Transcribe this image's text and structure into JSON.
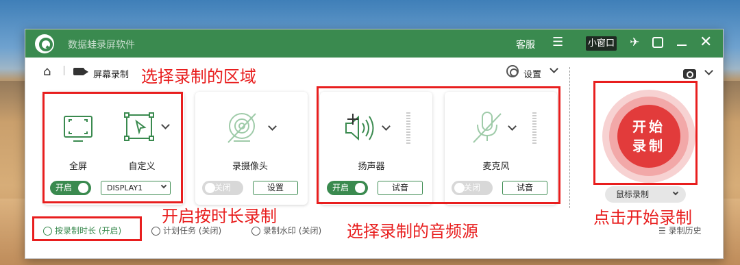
{
  "titlebar": {
    "app_title": "数据蛙录屏软件",
    "service": "客服",
    "menu_icon": "menu-icon",
    "mini_window": "小窗口"
  },
  "breadcrumb": {
    "label": "屏幕录制"
  },
  "settings": {
    "label": "设置"
  },
  "screen_card": {
    "full_label": "全屏",
    "custom_label": "自定义",
    "toggle": "开启",
    "display": "DISPLAY1"
  },
  "camera_card": {
    "label": "录摄像头",
    "toggle": "关闭",
    "button": "设置"
  },
  "speaker_card": {
    "label": "扬声器",
    "toggle": "开启",
    "button": "试音"
  },
  "mic_card": {
    "label": "麦克风",
    "toggle": "关闭",
    "button": "试音"
  },
  "record": {
    "line1": "开始",
    "line2": "录制",
    "mouse_label": "鼠标录制"
  },
  "bottom_bar": {
    "duration": "按录制时长 (开启)",
    "schedule": "计划任务 (关闭)",
    "watermark": "录制水印 (关闭)",
    "history": "录制历史"
  },
  "annotations": {
    "select_area": "选择录制的区域",
    "duration": "开启按时长录制",
    "audio_source": "选择录制的音频源",
    "start": "点击开始录制"
  },
  "colors": {
    "brand_green": "#3a8a4f",
    "record_red": "#e23b3b",
    "annotation_red": "#e81e1e"
  }
}
